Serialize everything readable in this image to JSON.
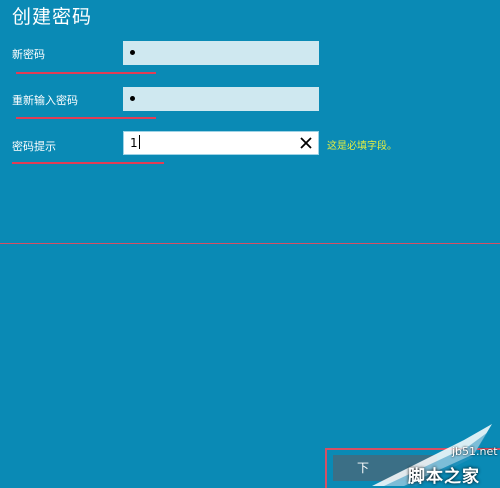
{
  "page": {
    "title": "创建密码"
  },
  "form": {
    "new_password": {
      "label": "新密码",
      "value_mask": "•"
    },
    "confirm_password": {
      "label": "重新输入密码",
      "value_mask": "•"
    },
    "hint": {
      "label": "密码提示",
      "value": "1",
      "required_message": "这是必填字段。"
    }
  },
  "footer": {
    "next_label": "下"
  },
  "watermark": {
    "url": "jb51.net",
    "site_name": "脚本之家"
  },
  "colors": {
    "background": "#0a8ab5",
    "annotation_red": "#e23d56",
    "warning_yellow": "#e6ef3f"
  }
}
